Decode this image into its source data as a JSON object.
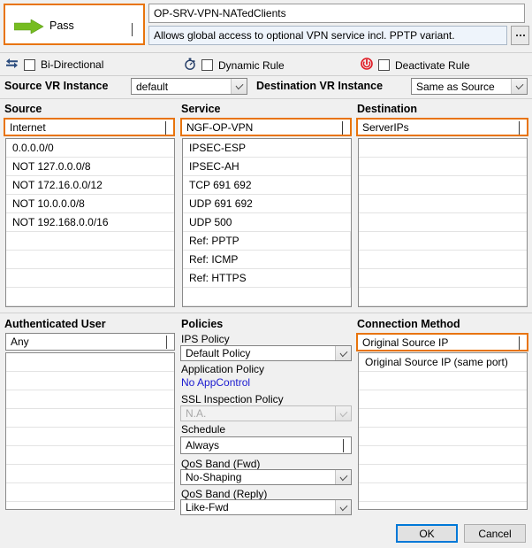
{
  "action": {
    "label": "Pass",
    "icon": "green-right-arrow-icon",
    "color": "#76BC21"
  },
  "rule": {
    "name_value": "OP-SRV-VPN-NATedClients",
    "description_value": "Allows global access to optional  VPN service incl. PPTP variant.",
    "browse_button": "…"
  },
  "options": [
    {
      "label": "Bi-Directional",
      "icon": "bidirectional-arrows-icon",
      "checked": false,
      "icon_color": "#2B4C7E"
    },
    {
      "label": "Dynamic Rule",
      "icon": "stopwatch-icon",
      "checked": false,
      "icon_color": "#1F3864"
    },
    {
      "label": "Deactivate Rule",
      "icon": "power-icon",
      "checked": false,
      "icon_color": "#E01B24"
    }
  ],
  "vr": {
    "source_label": "Source VR Instance",
    "source_value": "default",
    "destination_label": "Destination VR Instance",
    "destination_value": "Same as Source"
  },
  "source": {
    "header": "Source",
    "selected": "Internet",
    "items": [
      "0.0.0.0/0",
      "NOT 127.0.0.0/8",
      "NOT 172.16.0.0/12",
      "NOT 10.0.0.0/8",
      "NOT 192.168.0.0/16"
    ]
  },
  "service": {
    "header": "Service",
    "selected": "NGF-OP-VPN",
    "items": [
      "IPSEC-ESP",
      "IPSEC-AH",
      "TCP  691 692",
      "UDP  691 692",
      "UDP  500",
      "Ref: PPTP",
      "Ref: ICMP",
      "Ref: HTTPS"
    ]
  },
  "destination": {
    "header": "Destination",
    "selected": "ServerIPs",
    "items": []
  },
  "authenticated_user": {
    "header": "Authenticated User",
    "selected": "Any",
    "items": []
  },
  "policies": {
    "header": "Policies",
    "ips_label": "IPS Policy",
    "ips_value": "Default Policy",
    "application_label": "Application Policy",
    "application_value": "No AppControl",
    "ssl_label": "SSL Inspection Policy",
    "ssl_value": "N.A.",
    "schedule_label": "Schedule",
    "schedule_value": "Always",
    "qos_fwd_label": "QoS Band (Fwd)",
    "qos_fwd_value": "No-Shaping",
    "qos_reply_label": "QoS Band (Reply)",
    "qos_reply_value": "Like-Fwd"
  },
  "connection_method": {
    "header": "Connection Method",
    "selected": "Original Source IP",
    "items": [
      "Original Source IP (same port)"
    ]
  },
  "footer": {
    "ok": "OK",
    "cancel": "Cancel"
  }
}
